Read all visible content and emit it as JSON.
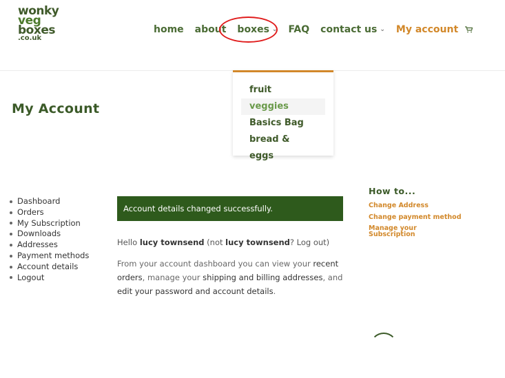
{
  "logo": {
    "line1": "wonky",
    "line2": "veg",
    "line3": "boxes",
    "line4": ".co.uk"
  },
  "nav": {
    "home": "home",
    "about": "about",
    "boxes": "boxes",
    "faq": "FAQ",
    "contact": "contact us",
    "my_account": "My account",
    "chevron": "⌄",
    "cart": "🛒"
  },
  "dropdown": {
    "items": [
      "fruit",
      "veggies",
      "Basics Bag",
      "bread & eggs"
    ],
    "hovered": "veggies"
  },
  "page_title": "My Account",
  "account_nav": {
    "items": [
      "Dashboard",
      "Orders",
      "My Subscription",
      "Downloads",
      "Addresses",
      "Payment methods",
      "Account details",
      "Logout"
    ]
  },
  "notice": "Account details changed successfully.",
  "hello": {
    "prefix": "Hello ",
    "name": "lucy townsend",
    "mid": " (not ",
    "name2": "lucy townsend",
    "suffix": "? Log out)"
  },
  "intro": {
    "p1": "From your account dashboard you can view your ",
    "recent_orders": "recent orders",
    "p2": ", manage your ",
    "addresses": "shipping and billing addresses",
    "p3": ", and ",
    "edit": "edit your password and account details",
    "p4": "."
  },
  "howto": {
    "title": "How to...",
    "links": [
      "Change Address",
      "Change payment method",
      "Manage your Subscription"
    ]
  },
  "colors": {
    "brand_green": "#3b5a28",
    "accent_orange": "#d2882a",
    "notice_bg": "#2e5a1c",
    "annotation_red": "#e01c1c"
  }
}
